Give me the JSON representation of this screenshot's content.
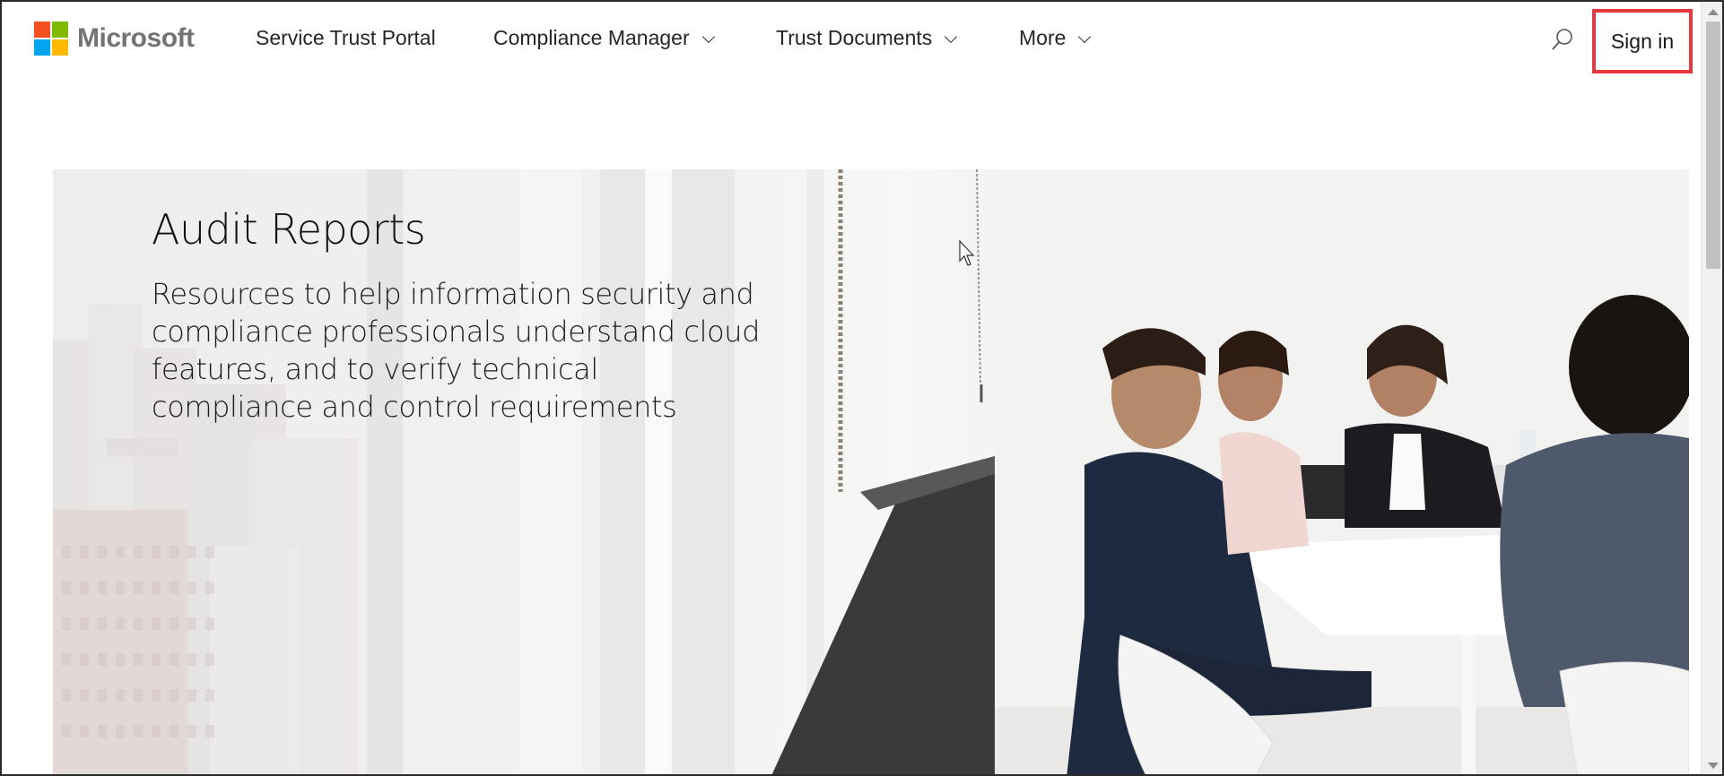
{
  "header": {
    "brand": "Microsoft",
    "logo_colors": [
      "#f25022",
      "#7fba00",
      "#00a4ef",
      "#ffb900"
    ],
    "nav": [
      {
        "label": "Service Trust Portal",
        "has_dropdown": false
      },
      {
        "label": "Compliance Manager",
        "has_dropdown": true
      },
      {
        "label": "Trust Documents",
        "has_dropdown": true
      },
      {
        "label": "More",
        "has_dropdown": true
      }
    ],
    "search_icon": "search-icon",
    "sign_in_label": "Sign in",
    "highlight_color": "#e8383d"
  },
  "hero": {
    "title": "Audit Reports",
    "description": "Resources to help information security and compliance professionals understand cloud features, and to verify technical compliance and control requirements"
  }
}
